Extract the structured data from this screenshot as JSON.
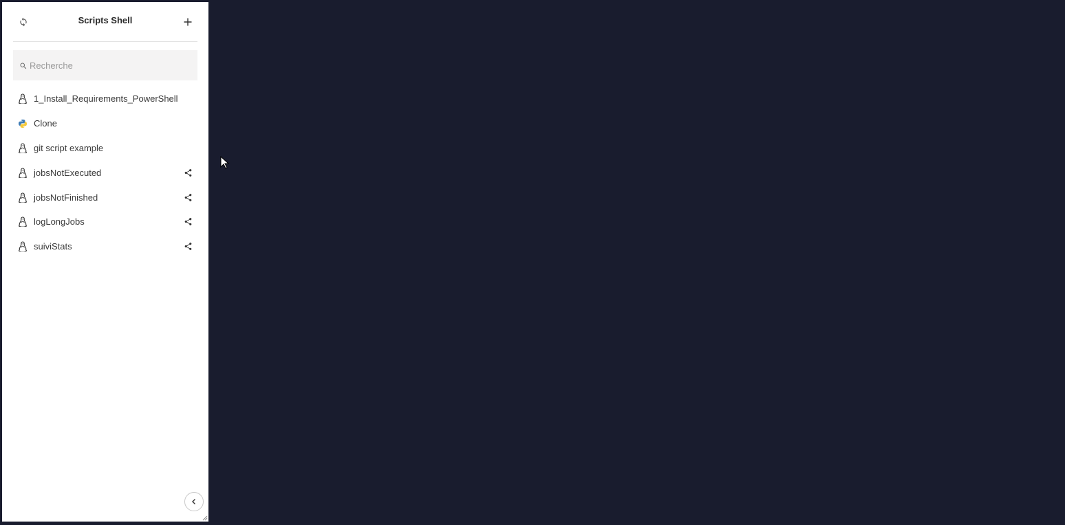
{
  "panel": {
    "title": "Scripts Shell",
    "refresh_icon": "refresh-icon",
    "add_icon": "plus-icon"
  },
  "search": {
    "placeholder": "Recherche",
    "value": "",
    "icon": "search-icon"
  },
  "scripts": [
    {
      "label": "1_Install_Requirements_PowerShell",
      "type": "linux",
      "icon": "linux-penguin-icon",
      "shared": false
    },
    {
      "label": "Clone",
      "type": "python",
      "icon": "python-icon",
      "shared": false
    },
    {
      "label": "git script example",
      "type": "linux",
      "icon": "linux-penguin-icon",
      "shared": false
    },
    {
      "label": "jobsNotExecuted",
      "type": "linux",
      "icon": "linux-penguin-icon",
      "shared": true
    },
    {
      "label": "jobsNotFinished",
      "type": "linux",
      "icon": "linux-penguin-icon",
      "shared": true
    },
    {
      "label": "logLongJobs",
      "type": "linux",
      "icon": "linux-penguin-icon",
      "shared": true
    },
    {
      "label": "suiviStats",
      "type": "linux",
      "icon": "linux-penguin-icon",
      "shared": true
    }
  ],
  "footer": {
    "collapse_icon": "chevron-left-icon"
  },
  "colors": {
    "background": "#191c2e",
    "panel": "#ffffff",
    "search_bg": "#f4f3f3",
    "text": "#3a3a3a",
    "python_blue": "#3f7cb6",
    "python_yellow": "#f5c93a"
  }
}
